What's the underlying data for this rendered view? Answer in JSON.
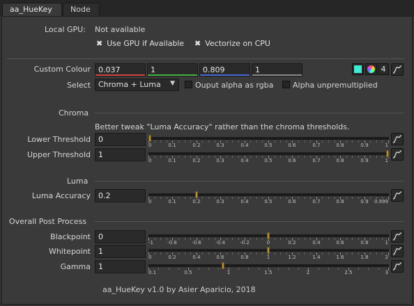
{
  "tabs": [
    {
      "label": "aa_HueKey",
      "active": true
    },
    {
      "label": "Node",
      "active": false
    }
  ],
  "local_gpu": {
    "label": "Local GPU:",
    "value": "Not available"
  },
  "gpu_options": {
    "use_gpu": "Use GPU if Available",
    "vectorize": "Vectorize on CPU"
  },
  "custom_colour": {
    "label": "Custom Colour",
    "values": [
      "0.037",
      "1",
      "0.809",
      "1"
    ],
    "channel_colors": [
      "#d64545",
      "#45b545",
      "#4a6ad6",
      "#8a8a8a"
    ],
    "swatch_color": "#3fe9d3",
    "count": "4"
  },
  "select": {
    "label": "Select",
    "value": "Chroma + Luma",
    "ouput_alpha": "Ouput alpha as rgba",
    "alpha_unpremult": "Alpha unpremultiplied"
  },
  "chroma": {
    "header": "Chroma",
    "note": "Better tweak \"Luma Accuracy\" rather than the chroma thresholds.",
    "lower": {
      "label": "Lower Threshold",
      "value": "0"
    },
    "upper": {
      "label": "Upper Threshold",
      "value": "1"
    }
  },
  "luma": {
    "header": "Luma",
    "accuracy": {
      "label": "Luma Accuracy",
      "value": "0.2"
    }
  },
  "post": {
    "header": "Overall Post Process",
    "blackpoint": {
      "label": "Blackpoint",
      "value": "0"
    },
    "whitepoint": {
      "label": "Whitepoint",
      "value": "1"
    },
    "gamma": {
      "label": "Gamma",
      "value": "1"
    }
  },
  "scales": {
    "unit": [
      "0",
      "0.1",
      "0.2",
      "0.3",
      "0.4",
      "0.5",
      "0.6",
      "0.7",
      "0.8",
      "0.9",
      "1"
    ],
    "luma": [
      "0",
      "0.1",
      "0.2",
      "0.3",
      "0.4",
      "0.5",
      "0.6",
      "0.7",
      "0.8",
      "0.9",
      "0.999"
    ],
    "blackpoint": [
      "-1",
      "-0.8",
      "-0.6",
      "-0.4",
      "-0.2",
      "0",
      "0.2",
      "0.4",
      "0.6",
      "0.8",
      "1"
    ],
    "whitepoint": [
      "0",
      "0.2",
      "0.4",
      "0.6",
      "0.8",
      "1",
      "1.2",
      "1.4",
      "1.6",
      "1.8",
      "2"
    ],
    "gamma": [
      "0.1",
      "0.5",
      "1",
      "1.5",
      "2",
      "2.5",
      "3"
    ]
  },
  "footer": "aa_HueKey v1.0 by Asier Aparicio, 2018"
}
